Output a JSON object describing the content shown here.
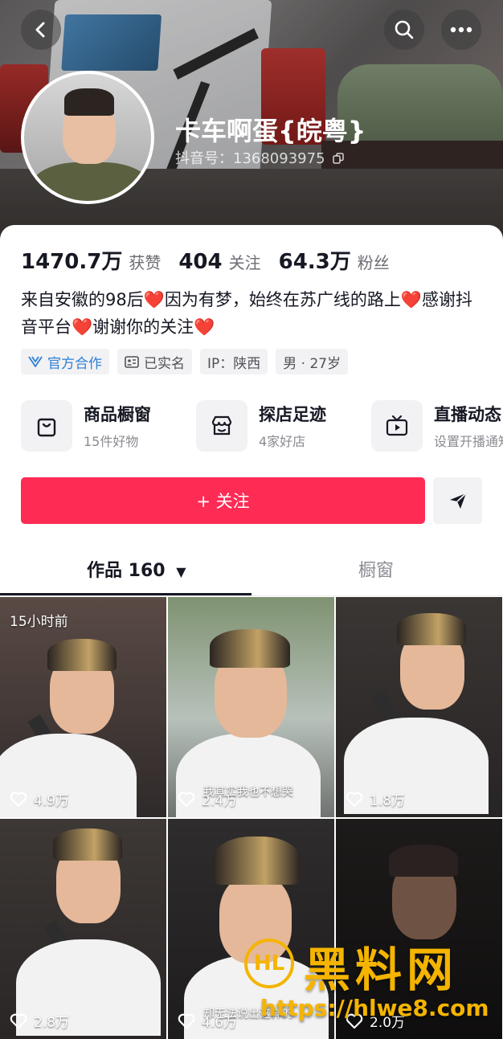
{
  "profile": {
    "nickname": "卡车啊蛋{皖粤}",
    "douyin_id": "抖音号：1368093975",
    "stats": [
      {
        "value": "1470.7万",
        "label": "获赞"
      },
      {
        "value": "404",
        "label": "关注"
      },
      {
        "value": "64.3万",
        "label": "粉丝"
      }
    ],
    "bio": {
      "part1": "来自安徽的98后",
      "part2": "因为有梦，始终在苏广线的路上",
      "part3": "感谢抖音平台",
      "part4": "谢谢你的关注",
      "heart": "❤️"
    },
    "tags": [
      {
        "label": "官方合作",
        "icon": "verified-icon"
      },
      {
        "label": "已实名",
        "icon": "id-card-icon"
      },
      {
        "label": "IP：陕西"
      },
      {
        "label": "男 · 27岁"
      }
    ]
  },
  "services": [
    {
      "title": "商品橱窗",
      "subtitle": "15件好物",
      "icon": "shopping-bag-icon"
    },
    {
      "title": "探店足迹",
      "subtitle": "4家好店",
      "icon": "store-icon"
    },
    {
      "title": "直播动态",
      "subtitle": "设置开播通知",
      "icon": "tv-icon"
    }
  ],
  "actions": {
    "follow_label": "+ 关注",
    "share_icon": "send-icon"
  },
  "tabs": {
    "works": "作品 160",
    "works_dropdown": "▼",
    "shop": "橱窗"
  },
  "videos": [
    {
      "likes": "4.9万",
      "pin": "15小时前"
    },
    {
      "likes": "2.4万",
      "subtitle": "我其实我也不想哭"
    },
    {
      "likes": "1.8万"
    },
    {
      "likes": "2.8万"
    },
    {
      "likes": "4.6万",
      "subtitle": "却无法说出这样的"
    },
    {
      "likes": "2.0万"
    }
  ],
  "watermark": {
    "logo": "HL",
    "text": "黑料网",
    "url": "https://hlwe8.com"
  },
  "colors": {
    "accent": "#fe2c55",
    "heart": "#e8262c",
    "official": "#2e7fd6",
    "watermark": "#f4b400"
  }
}
